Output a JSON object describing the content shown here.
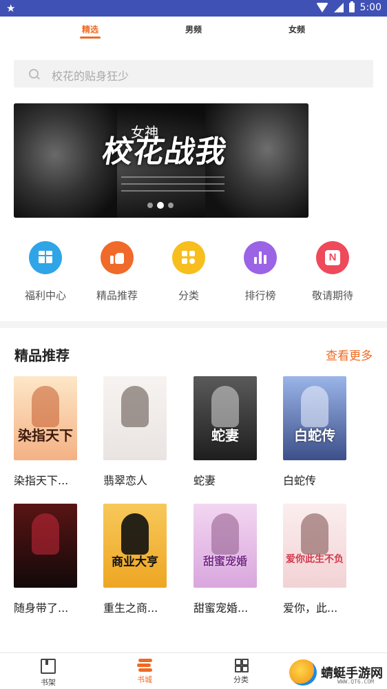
{
  "status_bar": {
    "time": "5:00"
  },
  "tabs": [
    {
      "label": "精选",
      "active": true
    },
    {
      "label": "男频",
      "active": false
    },
    {
      "label": "女频",
      "active": false
    }
  ],
  "search": {
    "placeholder": "校花的贴身狂少"
  },
  "banner": {
    "title_small": "女神",
    "title": "校花战我",
    "page_indicator": {
      "count": 3,
      "active_index": 1
    }
  },
  "entries": [
    {
      "label": "福利中心",
      "icon": "gift-icon",
      "color": "#2fa5e8"
    },
    {
      "label": "精品推荐",
      "icon": "thumbs-up-icon",
      "color": "#f06a2a"
    },
    {
      "label": "分类",
      "icon": "category-icon",
      "color": "#f7be1e"
    },
    {
      "label": "排行榜",
      "icon": "bar-chart-icon",
      "color": "#9b63e6"
    },
    {
      "label": "敬请期待",
      "icon": "n-logo-icon",
      "color": "#ee4a5a"
    }
  ],
  "section": {
    "title": "精品推荐",
    "more": "查看更多"
  },
  "books": [
    {
      "title": "染指天下...",
      "cover_text": "染指天下",
      "color": "#f4b183"
    },
    {
      "title": "翡翠恋人",
      "cover_text": "",
      "color": "#e9e4e1"
    },
    {
      "title": "蛇妻",
      "cover_text": "蛇妻",
      "color": "#3a3a3a"
    },
    {
      "title": "白蛇传",
      "cover_text": "白蛇传",
      "color": "#5b6fa8"
    },
    {
      "title": "随身带了...",
      "cover_text": "",
      "color": "#2a1a1a"
    },
    {
      "title": "重生之商...",
      "cover_text": "商业大亨",
      "color": "#f2b33d"
    },
    {
      "title": "甜蜜宠婚...",
      "cover_text": "甜蜜宠婚",
      "color": "#e7c3e6"
    },
    {
      "title": "爱你，此...",
      "cover_text": "爱你此生不负",
      "color": "#f6e1e2"
    }
  ],
  "bottom_nav": [
    {
      "label": "书架",
      "active": false
    },
    {
      "label": "书城",
      "active": true
    },
    {
      "label": "分类",
      "active": false
    }
  ],
  "watermark": {
    "text": "蜻蜓手游网",
    "url": "WWW.QT6.COM"
  },
  "colors": {
    "accent": "#ef6a22",
    "status_bar": "#3f51b5"
  }
}
